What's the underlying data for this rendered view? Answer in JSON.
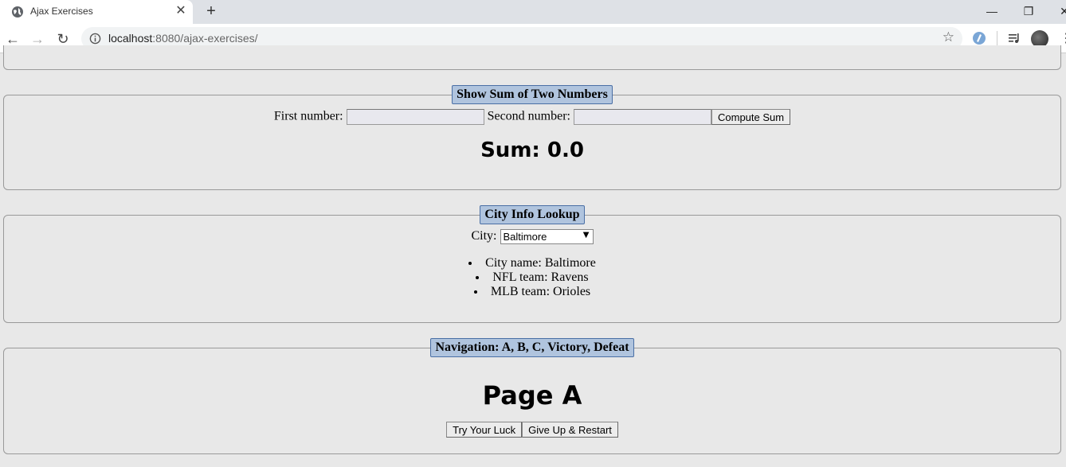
{
  "browser": {
    "tab_title": "Ajax Exercises",
    "url_host": "localhost",
    "url_rest": ":8080/ajax-exercises/"
  },
  "sum_section": {
    "legend": "Show Sum of Two Numbers",
    "first_label": "First number:",
    "first_value": "",
    "second_label": "Second number:",
    "second_value": "",
    "button_label": "Compute Sum",
    "result": "Sum: 0.0"
  },
  "city_section": {
    "legend": "City Info Lookup",
    "city_label": "City:",
    "selected_city": "Baltimore",
    "info": [
      "City name: Baltimore",
      "NFL team: Ravens",
      "MLB team: Orioles"
    ]
  },
  "nav_section": {
    "legend": "Navigation: A, B, C, Victory, Defeat",
    "page_title": "Page A",
    "try_label": "Try Your Luck",
    "give_up_label": "Give Up & Restart"
  }
}
